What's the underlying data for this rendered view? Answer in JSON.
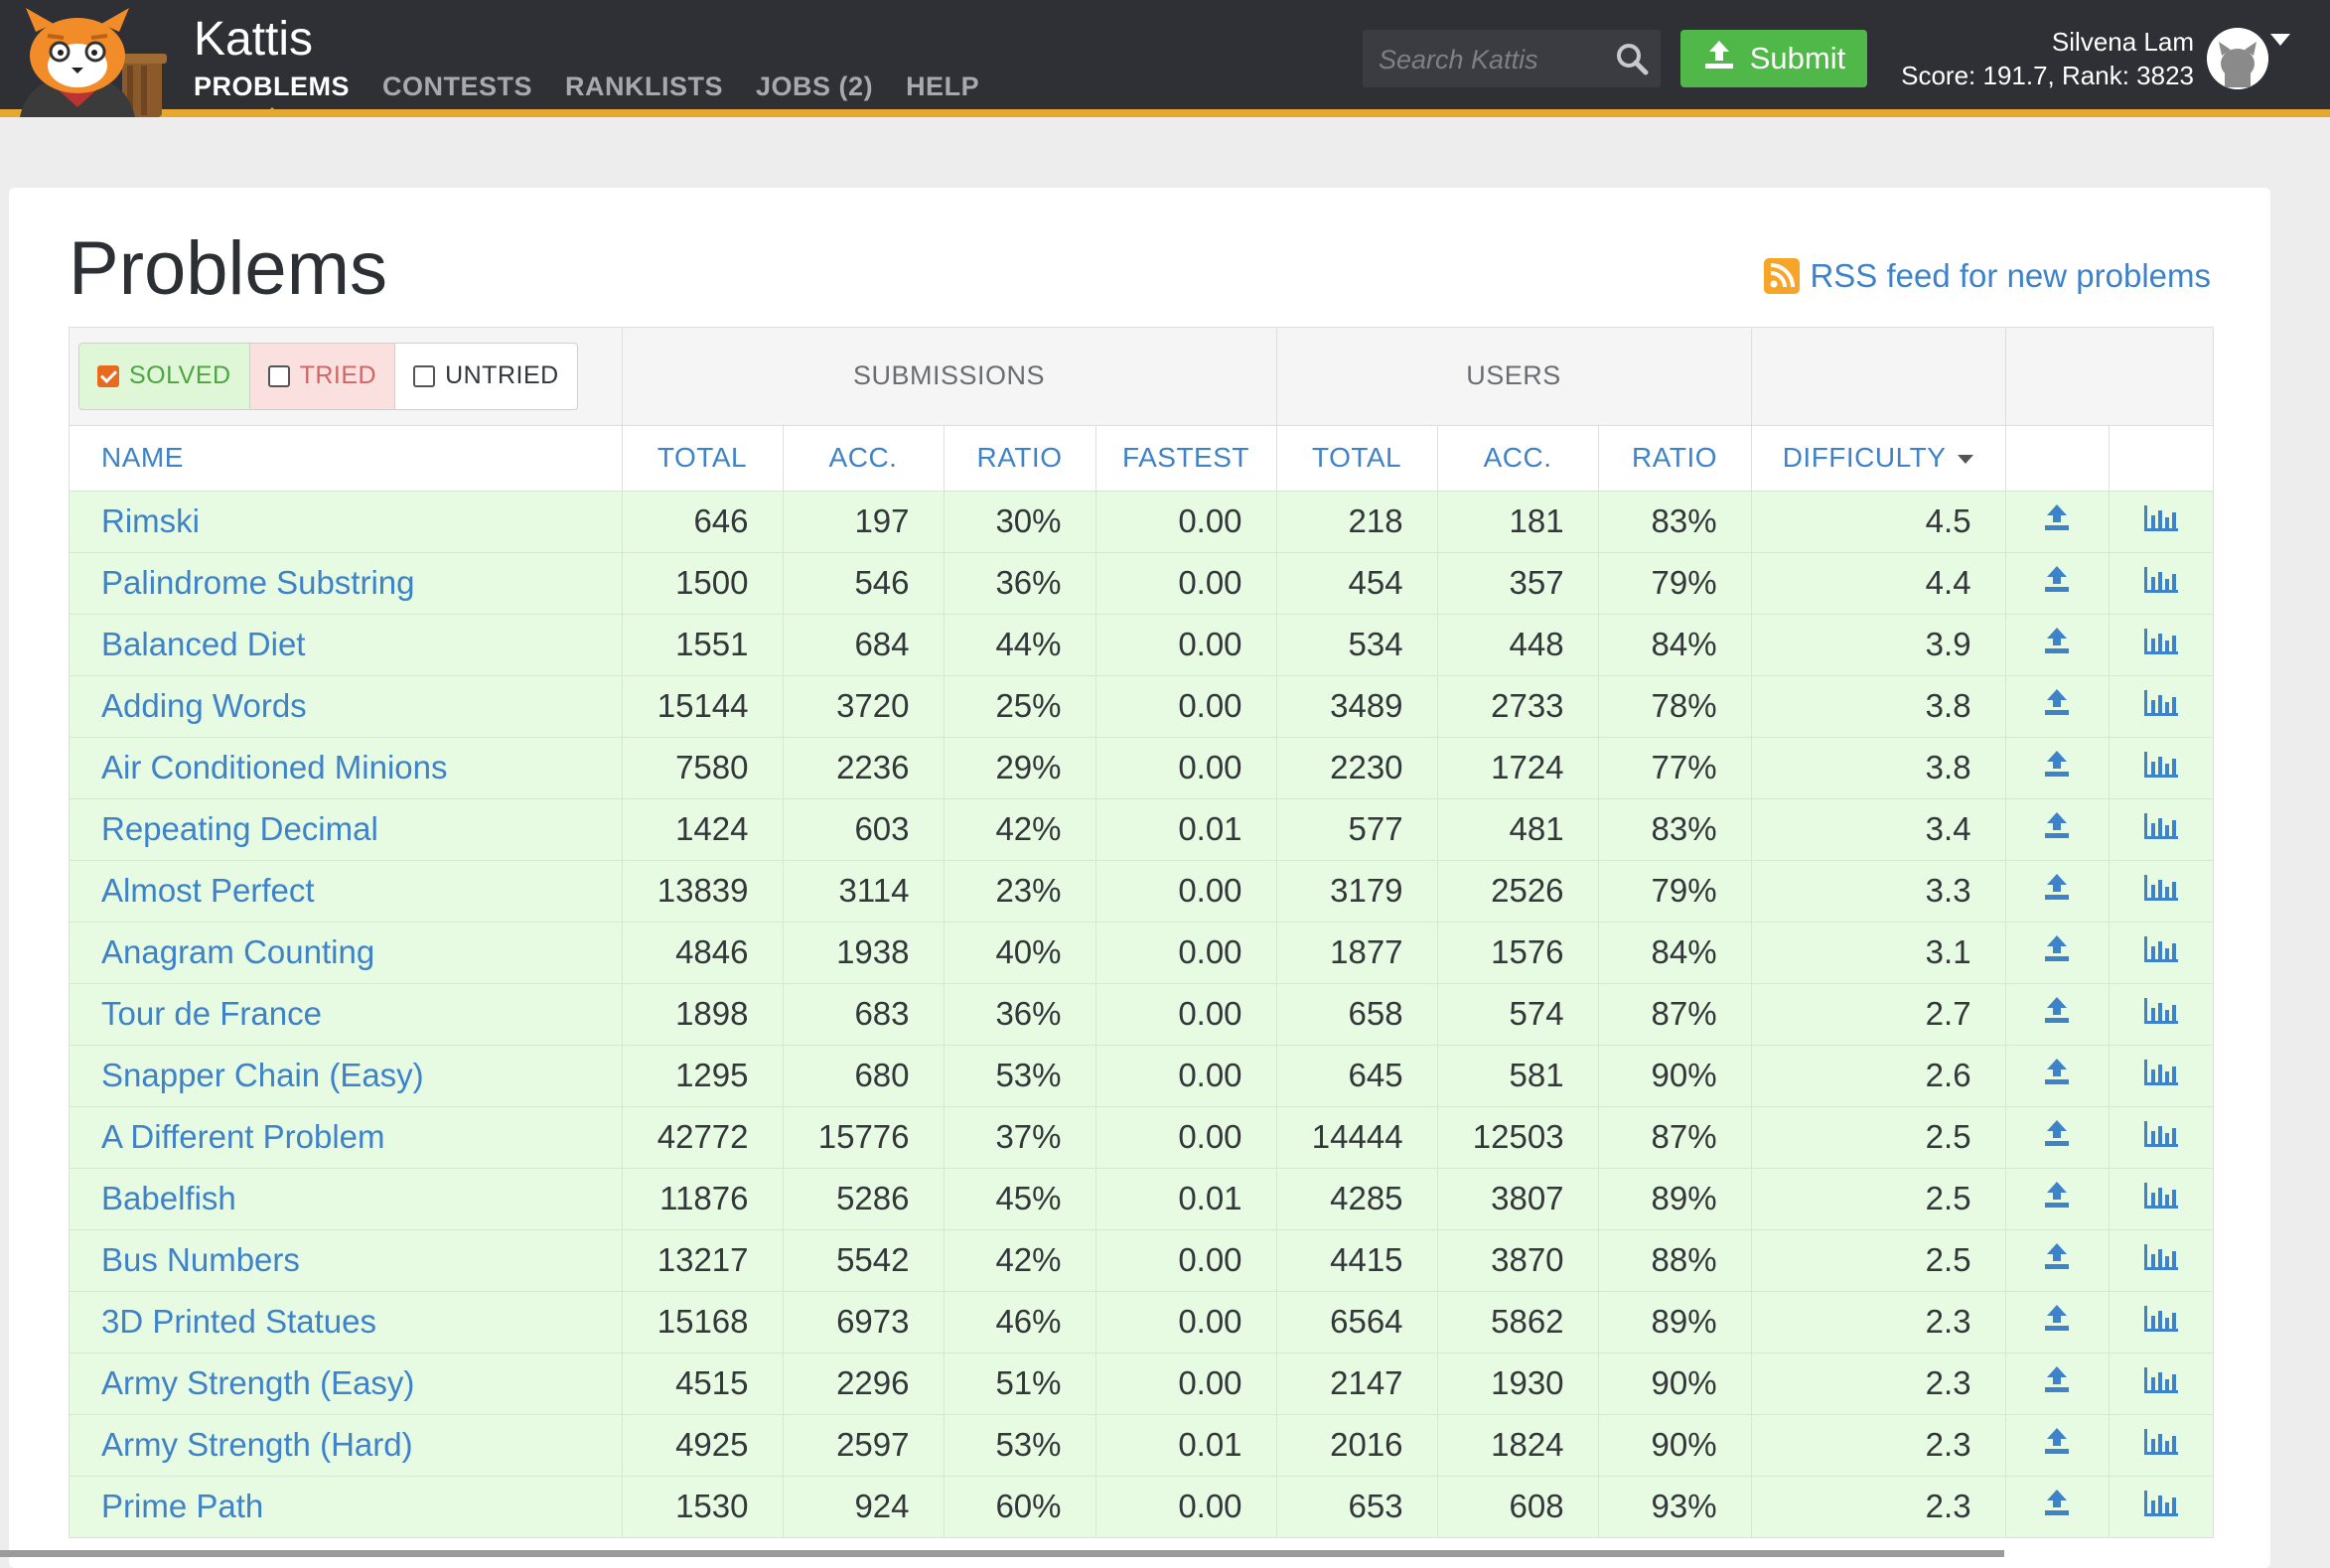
{
  "header": {
    "brand": "Kattis",
    "nav": [
      {
        "label": "PROBLEMS",
        "active": true
      },
      {
        "label": "CONTESTS",
        "active": false
      },
      {
        "label": "RANKLISTS",
        "active": false
      },
      {
        "label": "JOBS (2)",
        "active": false
      },
      {
        "label": "HELP",
        "active": false
      }
    ],
    "search_placeholder": "Search Kattis",
    "submit_label": "Submit",
    "user_name": "Silvena Lam",
    "user_score": "Score: 191.7, Rank: 3823",
    "accent_color": "#e7a82d",
    "submit_color": "#4fb848"
  },
  "page": {
    "title": "Problems",
    "rss_label": "RSS feed for new problems"
  },
  "filters": {
    "solved": {
      "label": "SOLVED",
      "checked": true
    },
    "tried": {
      "label": "TRIED",
      "checked": false
    },
    "untried": {
      "label": "UNTRIED",
      "checked": false
    }
  },
  "table": {
    "groups": {
      "submissions": "SUBMISSIONS",
      "users": "USERS"
    },
    "columns": [
      "NAME",
      "TOTAL",
      "ACC.",
      "RATIO",
      "FASTEST",
      "TOTAL",
      "ACC.",
      "RATIO",
      "DIFFICULTY"
    ],
    "rows": [
      [
        "Rimski",
        "646",
        "197",
        "30%",
        "0.00",
        "218",
        "181",
        "83%",
        "4.5"
      ],
      [
        "Palindrome Substring",
        "1500",
        "546",
        "36%",
        "0.00",
        "454",
        "357",
        "79%",
        "4.4"
      ],
      [
        "Balanced Diet",
        "1551",
        "684",
        "44%",
        "0.00",
        "534",
        "448",
        "84%",
        "3.9"
      ],
      [
        "Adding Words",
        "15144",
        "3720",
        "25%",
        "0.00",
        "3489",
        "2733",
        "78%",
        "3.8"
      ],
      [
        "Air Conditioned Minions",
        "7580",
        "2236",
        "29%",
        "0.00",
        "2230",
        "1724",
        "77%",
        "3.8"
      ],
      [
        "Repeating Decimal",
        "1424",
        "603",
        "42%",
        "0.01",
        "577",
        "481",
        "83%",
        "3.4"
      ],
      [
        "Almost Perfect",
        "13839",
        "3114",
        "23%",
        "0.00",
        "3179",
        "2526",
        "79%",
        "3.3"
      ],
      [
        "Anagram Counting",
        "4846",
        "1938",
        "40%",
        "0.00",
        "1877",
        "1576",
        "84%",
        "3.1"
      ],
      [
        "Tour de France",
        "1898",
        "683",
        "36%",
        "0.00",
        "658",
        "574",
        "87%",
        "2.7"
      ],
      [
        "Snapper Chain (Easy)",
        "1295",
        "680",
        "53%",
        "0.00",
        "645",
        "581",
        "90%",
        "2.6"
      ],
      [
        "A Different Problem",
        "42772",
        "15776",
        "37%",
        "0.00",
        "14444",
        "12503",
        "87%",
        "2.5"
      ],
      [
        "Babelfish",
        "11876",
        "5286",
        "45%",
        "0.01",
        "4285",
        "3807",
        "89%",
        "2.5"
      ],
      [
        "Bus Numbers",
        "13217",
        "5542",
        "42%",
        "0.00",
        "4415",
        "3870",
        "88%",
        "2.5"
      ],
      [
        "3D Printed Statues",
        "15168",
        "6973",
        "46%",
        "0.00",
        "6564",
        "5862",
        "89%",
        "2.3"
      ],
      [
        "Army Strength (Easy)",
        "4515",
        "2296",
        "51%",
        "0.00",
        "2147",
        "1930",
        "90%",
        "2.3"
      ],
      [
        "Army Strength (Hard)",
        "4925",
        "2597",
        "53%",
        "0.01",
        "2016",
        "1824",
        "90%",
        "2.3"
      ],
      [
        "Prime Path",
        "1530",
        "924",
        "60%",
        "0.00",
        "653",
        "608",
        "93%",
        "2.3"
      ]
    ],
    "row_color": "#e6fbe1",
    "link_color": "#3e82c9"
  }
}
